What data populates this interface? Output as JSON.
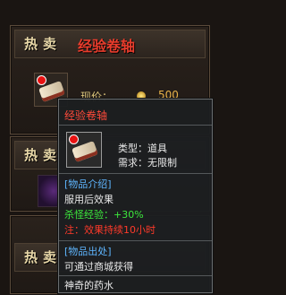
{
  "shop": {
    "cards": [
      {
        "hot_label": "热卖",
        "title": "经验卷轴",
        "price_label": "现价：",
        "price_value": "500"
      },
      {
        "hot_label": "热卖"
      },
      {
        "hot_label": "热卖"
      }
    ]
  },
  "tooltip": {
    "title": "经验卷轴",
    "type_label": "类型：道具",
    "req_label": "需求：无限制",
    "intro_header": "[物品介绍]",
    "intro_line": "服用后效果",
    "effect_line": "杀怪经验：+30%",
    "note_line": "注：效果持续10小时",
    "source_header": "[物品出处]",
    "source_line": "可通过商城获得",
    "footer": "神奇的药水"
  },
  "colors": {
    "title_red": "#ff4a3a",
    "header_blue": "#5fb6ff",
    "effect_green": "#3ce83c",
    "note_red": "#ff3a2a"
  }
}
